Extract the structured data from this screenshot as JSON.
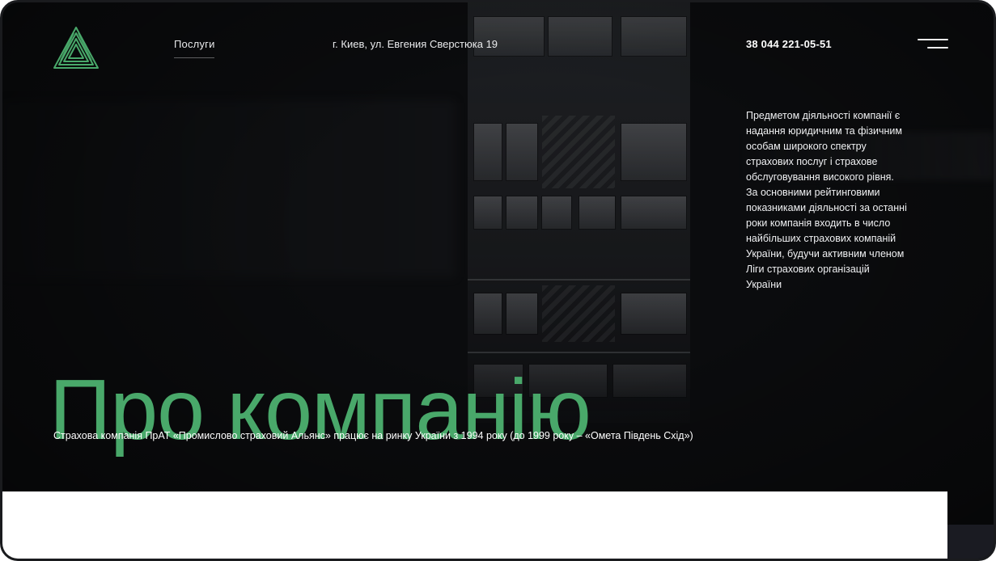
{
  "header": {
    "logo_name": "triangle-logo",
    "nav": {
      "services_label": "Послуги"
    },
    "address": "г. Киев, ул. Евгения Сверстюка 19",
    "phone": "38 044 221-05-51",
    "menu_icon": "hamburger-menu-icon"
  },
  "main": {
    "title": "Про компанію",
    "description": "Предметом діяльності компанії є надання юридичним та фізичним особам широкого спектру страхових послуг і страхове обслуговування високого рівня. За основними рейтинговими показниками діяльності за останні роки компанія входить в число найбільших страхових компаній України, будучи активним членом Ліги страхових організацій України",
    "intro": "Страхова компанія  ПрАТ «Промислово страховий Альянс» працює на ринку України з 1994 року (до 1999 року – «Омета Південь Схід»)"
  },
  "colors": {
    "background": "#0b0c0e",
    "accent_green": "#49a86a",
    "text_white": "#ffffff",
    "panel_white": "#ffffff"
  }
}
